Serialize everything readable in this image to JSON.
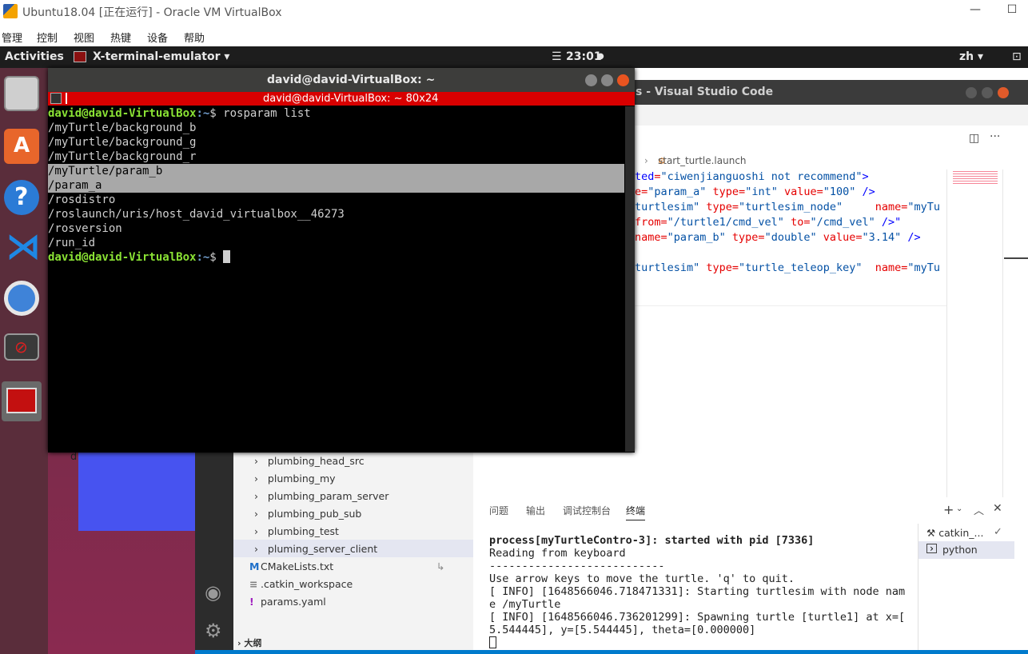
{
  "host": {
    "title": "Ubuntu18.04 [正在运行] - Oracle VM VirtualBox",
    "menu": [
      "管理",
      "控制",
      "视图",
      "热键",
      "设备",
      "帮助"
    ],
    "minimize": "—",
    "maximize": "☐"
  },
  "topbar": {
    "activities": "Activities",
    "app": "X-terminal-emulator ▾",
    "clock": "23:01",
    "lang": "zh ▾"
  },
  "dock": {
    "items": [
      "files-icon",
      "software-icon",
      "help-icon",
      "vscode-icon",
      "chromium-icon",
      "blocked-icon",
      "terminal-icon"
    ]
  },
  "desktop": {
    "label": "d"
  },
  "vscode": {
    "title": "s - Visual Studio Code",
    "breadcrumb": "start_turtle.launch",
    "code_lines": [
      [
        {
          "c": "tag",
          "t": "ted"
        },
        {
          "c": "attr",
          "t": "="
        },
        {
          "c": "str",
          "t": "\"ciwenjianguoshi not recommend\""
        },
        {
          "c": "tag",
          "t": ">"
        }
      ],
      [
        {
          "c": "attr",
          "t": "e="
        },
        {
          "c": "str",
          "t": "\"param_a\" "
        },
        {
          "c": "attr",
          "t": "type="
        },
        {
          "c": "str",
          "t": "\"int\" "
        },
        {
          "c": "attr",
          "t": "value="
        },
        {
          "c": "str",
          "t": "\"100\" "
        },
        {
          "c": "tag",
          "t": "/>"
        }
      ],
      [
        {
          "c": "str",
          "t": "turtlesim\" "
        },
        {
          "c": "attr",
          "t": "type="
        },
        {
          "c": "str",
          "t": "\"turtlesim_node\"     "
        },
        {
          "c": "attr",
          "t": "name="
        },
        {
          "c": "str",
          "t": "\"myTu"
        }
      ],
      [
        {
          "c": "attr",
          "t": "from="
        },
        {
          "c": "str",
          "t": "\"/turtle1/cmd_vel\" "
        },
        {
          "c": "attr",
          "t": "to="
        },
        {
          "c": "str",
          "t": "\"/cmd_vel\" "
        },
        {
          "c": "tag",
          "t": "/>\""
        }
      ],
      [
        {
          "c": "attr",
          "t": "name="
        },
        {
          "c": "str",
          "t": "\"param_b\" "
        },
        {
          "c": "attr",
          "t": "type="
        },
        {
          "c": "str",
          "t": "\"double\" "
        },
        {
          "c": "attr",
          "t": "value="
        },
        {
          "c": "str",
          "t": "\"3.14\" "
        },
        {
          "c": "tag",
          "t": "/>"
        }
      ],
      [],
      [
        {
          "c": "str",
          "t": "turtlesim\" "
        },
        {
          "c": "attr",
          "t": "type="
        },
        {
          "c": "str",
          "t": "\"turtle_teleop_key\"  "
        },
        {
          "c": "attr",
          "t": "name="
        },
        {
          "c": "str",
          "t": "\"myTu"
        }
      ]
    ],
    "tree": [
      "plumbing_head_src",
      "plumbing_my",
      "plumbing_param_server",
      "plumbing_pub_sub",
      "plumbing_test",
      "pluming_server_client"
    ],
    "files": [
      {
        "icon": "M",
        "name": "CMakeLists.txt",
        "badge": "↳"
      },
      {
        "icon": "≡",
        "name": ".catkin_workspace",
        "badge": ""
      },
      {
        "icon": "!",
        "name": "params.yaml",
        "badge": ""
      }
    ],
    "outline": "大纲",
    "panel_tabs": [
      "问题",
      "输出",
      "调试控制台",
      "终端"
    ],
    "terminal_lines": [
      "process[myTurtleContro-3]: started with pid [7336]",
      "Reading from keyboard",
      "---------------------------",
      "Use arrow keys to move the turtle. 'q' to quit.",
      "[ INFO] [1648566046.718471331]: Starting turtlesim with node nam",
      "e /myTurtle",
      "[ INFO] [1648566046.736201299]: Spawning turtle [turtle1] at x=[",
      "5.544445], y=[5.544445], theta=[0.000000]"
    ],
    "terminals": [
      "catkin_...",
      "python"
    ]
  },
  "terminal": {
    "title": "david@david-VirtualBox: ~",
    "subtitle": "david@david-VirtualBox: ~ 80x24",
    "prompt_user": "david@david-VirtualBox",
    "prompt_path": ":~",
    "command": "$ rosparam list",
    "output": [
      "/myTurtle/background_b",
      "/myTurtle/background_g",
      "/myTurtle/background_r",
      "/myTurtle/param_b",
      "/param_a",
      "/rosdistro",
      "/roslaunch/uris/host_david_virtualbox__46273",
      "/rosversion",
      "/run_id"
    ],
    "selected": [
      "/myTurtle/param_b",
      "/param_a"
    ],
    "prompt_end": "$ "
  }
}
